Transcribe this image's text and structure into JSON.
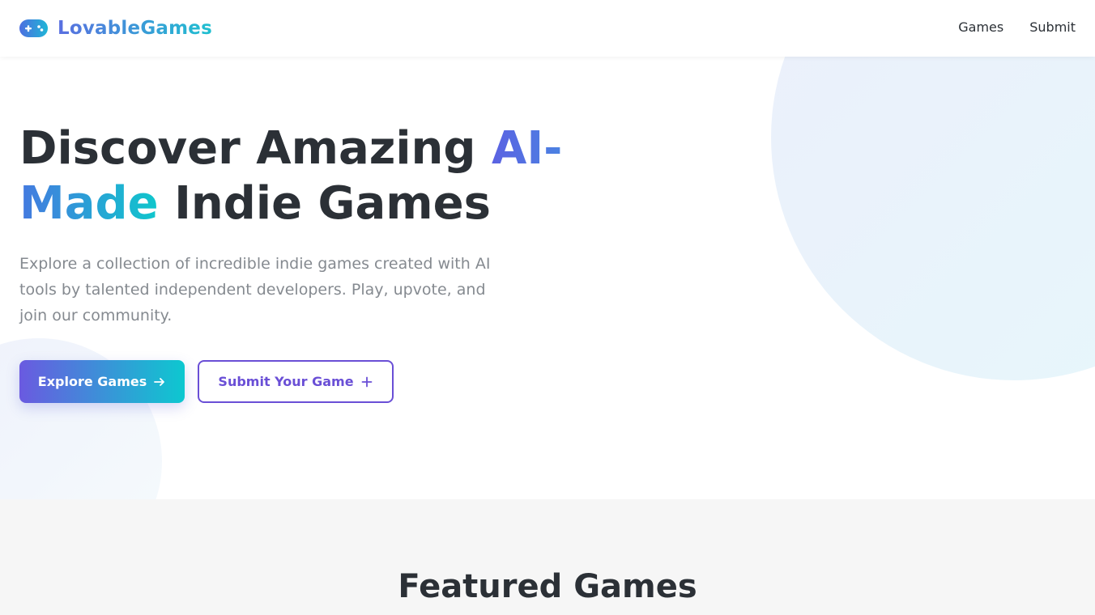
{
  "header": {
    "logo_text": "LovableGames",
    "logo_icon": "gamepad-icon",
    "nav": [
      {
        "label": "Games"
      },
      {
        "label": "Submit"
      }
    ]
  },
  "hero": {
    "headline_part1": "Discover Amazing ",
    "headline_accent1": "AI-",
    "headline_accent2": "Made",
    "headline_part2": " Indie Games",
    "subtext": "Explore a collection of incredible indie games created with AI tools by talented independent developers. Play, upvote, and join our community.",
    "primary_button": {
      "label": "Explore Games",
      "icon": "arrow-right-icon"
    },
    "secondary_button": {
      "label": "Submit Your Game",
      "icon": "plus-icon"
    }
  },
  "featured": {
    "title": "Featured Games"
  },
  "colors": {
    "brand_start": "#6a5ae0",
    "brand_end": "#0dc8d0",
    "text": "#2b3036",
    "muted": "#858a90"
  }
}
